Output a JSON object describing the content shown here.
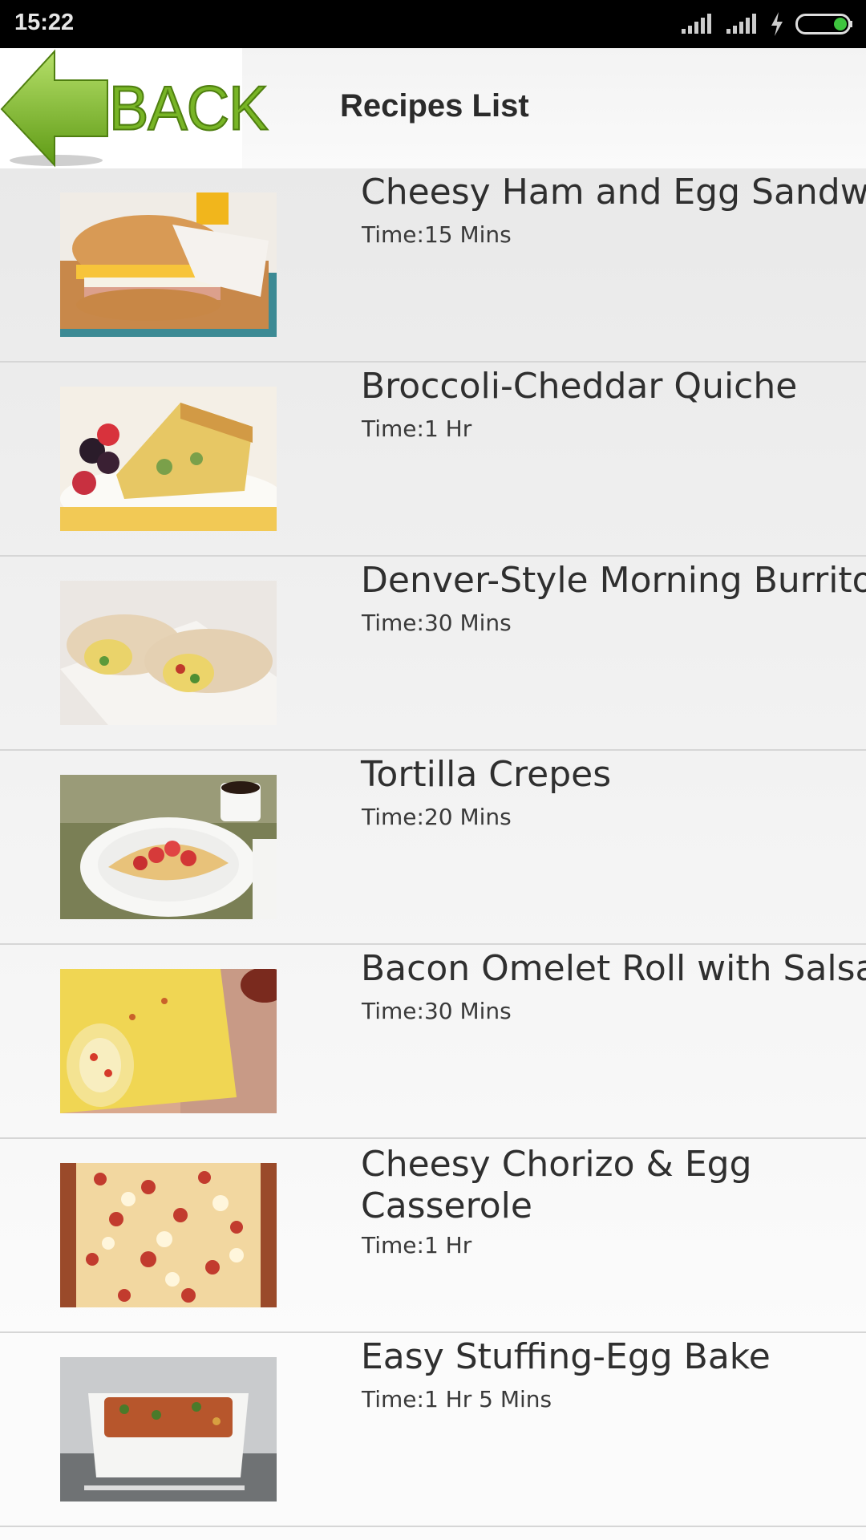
{
  "status_bar": {
    "time": "15:22"
  },
  "header": {
    "back_label": "BACK",
    "title": "Recipes List"
  },
  "recipes": [
    {
      "name": "Cheesy Ham and Egg Sandwich",
      "time": "Time:15 Mins",
      "image": "ham-egg-sandwich-image"
    },
    {
      "name": "Broccoli-Cheddar Quiche",
      "time": "Time:1 Hr",
      "image": "quiche-image"
    },
    {
      "name": "Denver-Style Morning Burrito",
      "time": "Time:30 Mins",
      "image": "burrito-image"
    },
    {
      "name": "Tortilla Crepes",
      "time": "Time:20 Mins",
      "image": "crepes-image"
    },
    {
      "name": "Bacon Omelet Roll with Salsa",
      "time": "Time:30 Mins",
      "image": "omelet-roll-image"
    },
    {
      "name": "Cheesy Chorizo & Egg Casserole",
      "time": "Time:1 Hr",
      "image": "casserole-image"
    },
    {
      "name": "Easy Stuffing-Egg Bake",
      "time": "Time:1 Hr 5 Mins",
      "image": "egg-bake-image"
    }
  ],
  "colors": {
    "back_green": "#78b526",
    "status_bar": "#000000",
    "battery_green": "#3ec43e"
  }
}
